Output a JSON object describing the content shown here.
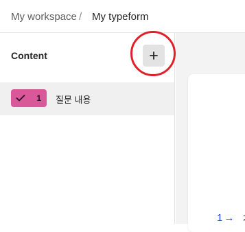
{
  "breadcrumb": {
    "workspace": "My workspace",
    "separator": "/",
    "form": "My typeform"
  },
  "sidebar": {
    "title": "Content",
    "add_button_label": "+",
    "questions": [
      {
        "number": "1",
        "label": "질문 내용",
        "type_icon": "checkmark-icon"
      }
    ]
  },
  "preview": {
    "question_number": "1",
    "arrow": "→",
    "partial_text": "ㅈ"
  },
  "colors": {
    "badge": "#d9589a",
    "highlight_ring": "#e0202a",
    "preview_number": "#1e3cff"
  }
}
